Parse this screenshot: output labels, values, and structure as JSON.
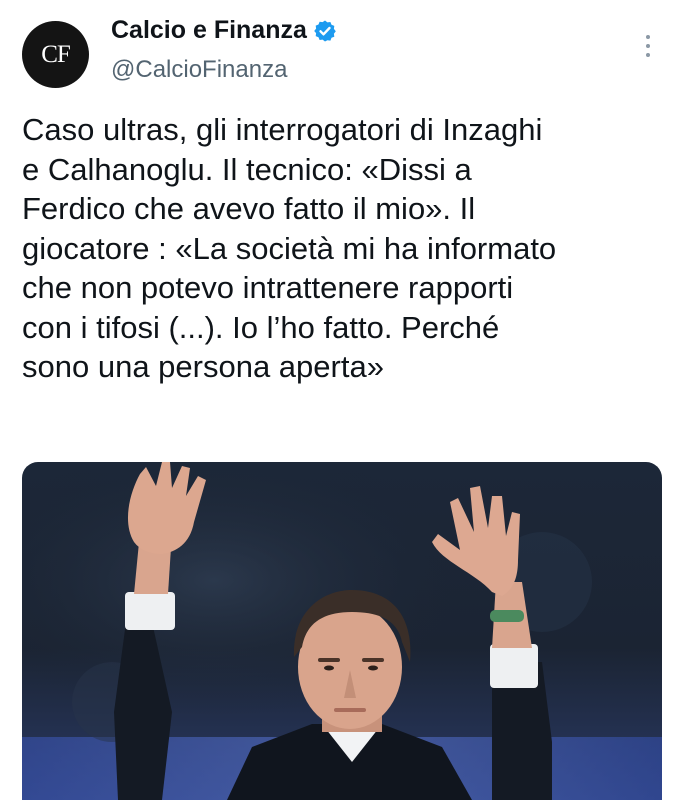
{
  "tweet": {
    "avatar_text": "CF",
    "display_name": "Calcio e Finanza",
    "handle": "@CalcioFinanza",
    "verified": true,
    "text": "Caso ultras, gli interrogatori di Inzaghi\ne Calhanoglu. Il tecnico: «Dissi a\nFerdico che avevo fatto il mio». Il\ngiocatore : «La società mi ha informato\nche non potevo intrattenere rapporti\ncon i tifosi (...). Io l’ho fatto. Perché\nsono una persona aperta»"
  },
  "icons": {
    "verified": "verified-badge-icon",
    "more": "more-vertical-icon"
  },
  "colors": {
    "verified_blue": "#1d9bf0",
    "handle_gray": "#536471",
    "text": "#0f1419"
  }
}
